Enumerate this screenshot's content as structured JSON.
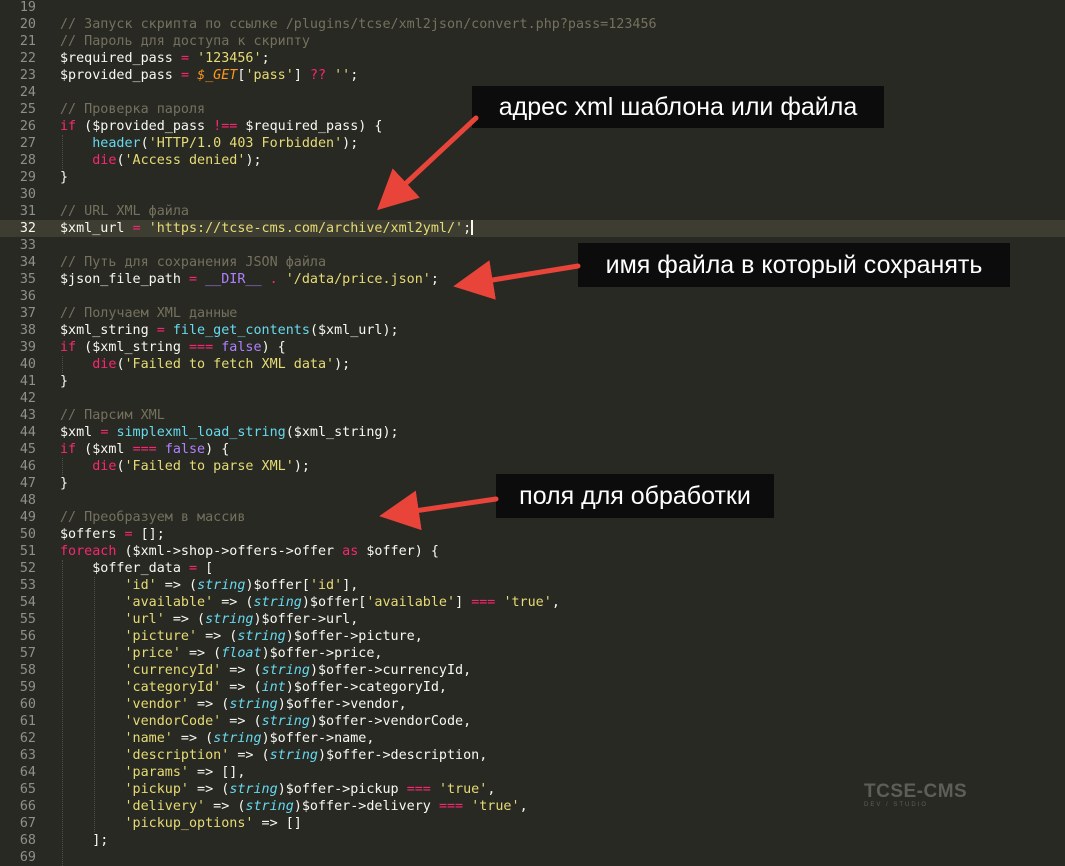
{
  "editor": {
    "current_line": 32,
    "lines": [
      {
        "n": "19",
        "t": []
      },
      {
        "n": "20",
        "t": [
          [
            "c",
            "// Запуск скрипта по ссылке /plugins/tcse/xml2json/convert.php?pass=123456"
          ]
        ]
      },
      {
        "n": "21",
        "t": [
          [
            "c",
            "// Пароль для доступа к скрипту"
          ]
        ]
      },
      {
        "n": "22",
        "t": [
          [
            "",
            "$required_pass "
          ],
          [
            "k",
            "="
          ],
          [
            "",
            " "
          ],
          [
            "s",
            "'123456'"
          ],
          [
            "",
            ";"
          ]
        ]
      },
      {
        "n": "23",
        "t": [
          [
            "",
            "$provided_pass "
          ],
          [
            "k",
            "="
          ],
          [
            "",
            " "
          ],
          [
            "g",
            "$_GET"
          ],
          [
            "",
            "["
          ],
          [
            "s",
            "'pass'"
          ],
          [
            "",
            "] "
          ],
          [
            "k",
            "??"
          ],
          [
            "",
            " "
          ],
          [
            "s",
            "''"
          ],
          [
            "",
            ";"
          ]
        ]
      },
      {
        "n": "24",
        "t": []
      },
      {
        "n": "25",
        "t": [
          [
            "c",
            "// Проверка пароля"
          ]
        ]
      },
      {
        "n": "26",
        "t": [
          [
            "k",
            "if"
          ],
          [
            "",
            " ($provided_pass "
          ],
          [
            "k",
            "!=="
          ],
          [
            "",
            " $required_pass) {"
          ]
        ]
      },
      {
        "n": "27",
        "t": [
          [
            "",
            "    "
          ],
          [
            "f",
            "header"
          ],
          [
            "",
            "("
          ],
          [
            "s",
            "'HTTP/1.0 403 Forbidden'"
          ],
          [
            "",
            ");"
          ]
        ]
      },
      {
        "n": "28",
        "t": [
          [
            "",
            "    "
          ],
          [
            "k",
            "die"
          ],
          [
            "",
            "("
          ],
          [
            "s",
            "'Access denied'"
          ],
          [
            "",
            ");"
          ]
        ]
      },
      {
        "n": "29",
        "t": [
          [
            "",
            "}"
          ]
        ]
      },
      {
        "n": "30",
        "t": []
      },
      {
        "n": "31",
        "t": [
          [
            "c",
            "// URL XML файла"
          ]
        ]
      },
      {
        "n": "32",
        "t": [
          [
            "",
            "$xml_url "
          ],
          [
            "k",
            "="
          ],
          [
            "",
            " "
          ],
          [
            "s",
            "'https://tcse-cms.com/archive/xml2yml/'"
          ],
          [
            "",
            ";"
          ]
        ],
        "cursor": true
      },
      {
        "n": "33",
        "t": []
      },
      {
        "n": "34",
        "t": [
          [
            "c",
            "// Путь для сохранения JSON файла"
          ]
        ]
      },
      {
        "n": "35",
        "t": [
          [
            "",
            "$json_file_path "
          ],
          [
            "k",
            "="
          ],
          [
            "",
            " "
          ],
          [
            "b",
            "__DIR__"
          ],
          [
            "",
            " "
          ],
          [
            "k",
            "."
          ],
          [
            "",
            " "
          ],
          [
            "s",
            "'/data/price.json'"
          ],
          [
            "",
            ";"
          ]
        ]
      },
      {
        "n": "36",
        "t": []
      },
      {
        "n": "37",
        "t": [
          [
            "c",
            "// Получаем XML данные"
          ]
        ]
      },
      {
        "n": "38",
        "t": [
          [
            "",
            "$xml_string "
          ],
          [
            "k",
            "="
          ],
          [
            "",
            " "
          ],
          [
            "f",
            "file_get_contents"
          ],
          [
            "",
            "($xml_url);"
          ]
        ]
      },
      {
        "n": "39",
        "t": [
          [
            "k",
            "if"
          ],
          [
            "",
            " ($xml_string "
          ],
          [
            "k",
            "==="
          ],
          [
            "",
            " "
          ],
          [
            "b",
            "false"
          ],
          [
            "",
            ") {"
          ]
        ]
      },
      {
        "n": "40",
        "t": [
          [
            "",
            "    "
          ],
          [
            "k",
            "die"
          ],
          [
            "",
            "("
          ],
          [
            "s",
            "'Failed to fetch XML data'"
          ],
          [
            "",
            ");"
          ]
        ]
      },
      {
        "n": "41",
        "t": [
          [
            "",
            "}"
          ]
        ]
      },
      {
        "n": "42",
        "t": []
      },
      {
        "n": "43",
        "t": [
          [
            "c",
            "// Парсим XML"
          ]
        ]
      },
      {
        "n": "44",
        "t": [
          [
            "",
            "$xml "
          ],
          [
            "k",
            "="
          ],
          [
            "",
            " "
          ],
          [
            "f",
            "simplexml_load_string"
          ],
          [
            "",
            "($xml_string);"
          ]
        ]
      },
      {
        "n": "45",
        "t": [
          [
            "k",
            "if"
          ],
          [
            "",
            " ($xml "
          ],
          [
            "k",
            "==="
          ],
          [
            "",
            " "
          ],
          [
            "b",
            "false"
          ],
          [
            "",
            ") {"
          ]
        ]
      },
      {
        "n": "46",
        "t": [
          [
            "",
            "    "
          ],
          [
            "k",
            "die"
          ],
          [
            "",
            "("
          ],
          [
            "s",
            "'Failed to parse XML'"
          ],
          [
            "",
            ");"
          ]
        ]
      },
      {
        "n": "47",
        "t": [
          [
            "",
            "}"
          ]
        ]
      },
      {
        "n": "48",
        "t": []
      },
      {
        "n": "49",
        "t": [
          [
            "c",
            "// Преобразуем в массив"
          ]
        ]
      },
      {
        "n": "50",
        "t": [
          [
            "",
            "$offers "
          ],
          [
            "k",
            "="
          ],
          [
            "",
            " [];"
          ]
        ]
      },
      {
        "n": "51",
        "t": [
          [
            "k",
            "foreach"
          ],
          [
            "",
            " ($xml->shop->offers->offer "
          ],
          [
            "k",
            "as"
          ],
          [
            "",
            " $offer) {"
          ]
        ]
      },
      {
        "n": "52",
        "t": [
          [
            "",
            "    $offer_data "
          ],
          [
            "k",
            "="
          ],
          [
            "",
            " ["
          ]
        ]
      },
      {
        "n": "53",
        "t": [
          [
            "",
            "        "
          ],
          [
            "s",
            "'id'"
          ],
          [
            "",
            " => ("
          ],
          [
            "t",
            "string"
          ],
          [
            "",
            ")$offer["
          ],
          [
            "s",
            "'id'"
          ],
          [
            "",
            "],"
          ]
        ]
      },
      {
        "n": "54",
        "t": [
          [
            "",
            "        "
          ],
          [
            "s",
            "'available'"
          ],
          [
            "",
            " => ("
          ],
          [
            "t",
            "string"
          ],
          [
            "",
            ")$offer["
          ],
          [
            "s",
            "'available'"
          ],
          [
            "",
            "] "
          ],
          [
            "k",
            "==="
          ],
          [
            "",
            " "
          ],
          [
            "s",
            "'true'"
          ],
          [
            "",
            ","
          ]
        ]
      },
      {
        "n": "55",
        "t": [
          [
            "",
            "        "
          ],
          [
            "s",
            "'url'"
          ],
          [
            "",
            " => ("
          ],
          [
            "t",
            "string"
          ],
          [
            "",
            ")$offer->url,"
          ]
        ]
      },
      {
        "n": "56",
        "t": [
          [
            "",
            "        "
          ],
          [
            "s",
            "'picture'"
          ],
          [
            "",
            " => ("
          ],
          [
            "t",
            "string"
          ],
          [
            "",
            ")$offer->picture,"
          ]
        ]
      },
      {
        "n": "57",
        "t": [
          [
            "",
            "        "
          ],
          [
            "s",
            "'price'"
          ],
          [
            "",
            " => ("
          ],
          [
            "t",
            "float"
          ],
          [
            "",
            ")$offer->price,"
          ]
        ]
      },
      {
        "n": "58",
        "t": [
          [
            "",
            "        "
          ],
          [
            "s",
            "'currencyId'"
          ],
          [
            "",
            " => ("
          ],
          [
            "t",
            "string"
          ],
          [
            "",
            ")$offer->currencyId,"
          ]
        ]
      },
      {
        "n": "59",
        "t": [
          [
            "",
            "        "
          ],
          [
            "s",
            "'categoryId'"
          ],
          [
            "",
            " => ("
          ],
          [
            "t",
            "int"
          ],
          [
            "",
            ")$offer->categoryId,"
          ]
        ]
      },
      {
        "n": "60",
        "t": [
          [
            "",
            "        "
          ],
          [
            "s",
            "'vendor'"
          ],
          [
            "",
            " => ("
          ],
          [
            "t",
            "string"
          ],
          [
            "",
            ")$offer->vendor,"
          ]
        ]
      },
      {
        "n": "61",
        "t": [
          [
            "",
            "        "
          ],
          [
            "s",
            "'vendorCode'"
          ],
          [
            "",
            " => ("
          ],
          [
            "t",
            "string"
          ],
          [
            "",
            ")$offer->vendorCode,"
          ]
        ]
      },
      {
        "n": "62",
        "t": [
          [
            "",
            "        "
          ],
          [
            "s",
            "'name'"
          ],
          [
            "",
            " => ("
          ],
          [
            "t",
            "string"
          ],
          [
            "",
            ")$offer->name,"
          ]
        ]
      },
      {
        "n": "63",
        "t": [
          [
            "",
            "        "
          ],
          [
            "s",
            "'description'"
          ],
          [
            "",
            " => ("
          ],
          [
            "t",
            "string"
          ],
          [
            "",
            ")$offer->description,"
          ]
        ]
      },
      {
        "n": "64",
        "t": [
          [
            "",
            "        "
          ],
          [
            "s",
            "'params'"
          ],
          [
            "",
            " => [],"
          ]
        ]
      },
      {
        "n": "65",
        "t": [
          [
            "",
            "        "
          ],
          [
            "s",
            "'pickup'"
          ],
          [
            "",
            " => ("
          ],
          [
            "t",
            "string"
          ],
          [
            "",
            ")$offer->pickup "
          ],
          [
            "k",
            "==="
          ],
          [
            "",
            " "
          ],
          [
            "s",
            "'true'"
          ],
          [
            "",
            ","
          ]
        ]
      },
      {
        "n": "66",
        "t": [
          [
            "",
            "        "
          ],
          [
            "s",
            "'delivery'"
          ],
          [
            "",
            " => ("
          ],
          [
            "t",
            "string"
          ],
          [
            "",
            ")$offer->delivery "
          ],
          [
            "k",
            "==="
          ],
          [
            "",
            " "
          ],
          [
            "s",
            "'true'"
          ],
          [
            "",
            ","
          ]
        ]
      },
      {
        "n": "67",
        "t": [
          [
            "",
            "        "
          ],
          [
            "s",
            "'pickup_options'"
          ],
          [
            "",
            " => []"
          ]
        ]
      },
      {
        "n": "68",
        "t": [
          [
            "",
            "    ];"
          ]
        ]
      },
      {
        "n": "69",
        "t": []
      }
    ]
  },
  "callouts": {
    "xml_address": "адрес xml шаблона или файла",
    "json_file": "имя файла в который сохранять",
    "fields": "поля для обработки"
  },
  "watermark": {
    "brand": "TCSE-CMS",
    "tagline": "DEV / STUDIO"
  },
  "colors": {
    "background": "#282923",
    "arrow": "#e8443a",
    "callout_bg": "#0c0c0c"
  }
}
